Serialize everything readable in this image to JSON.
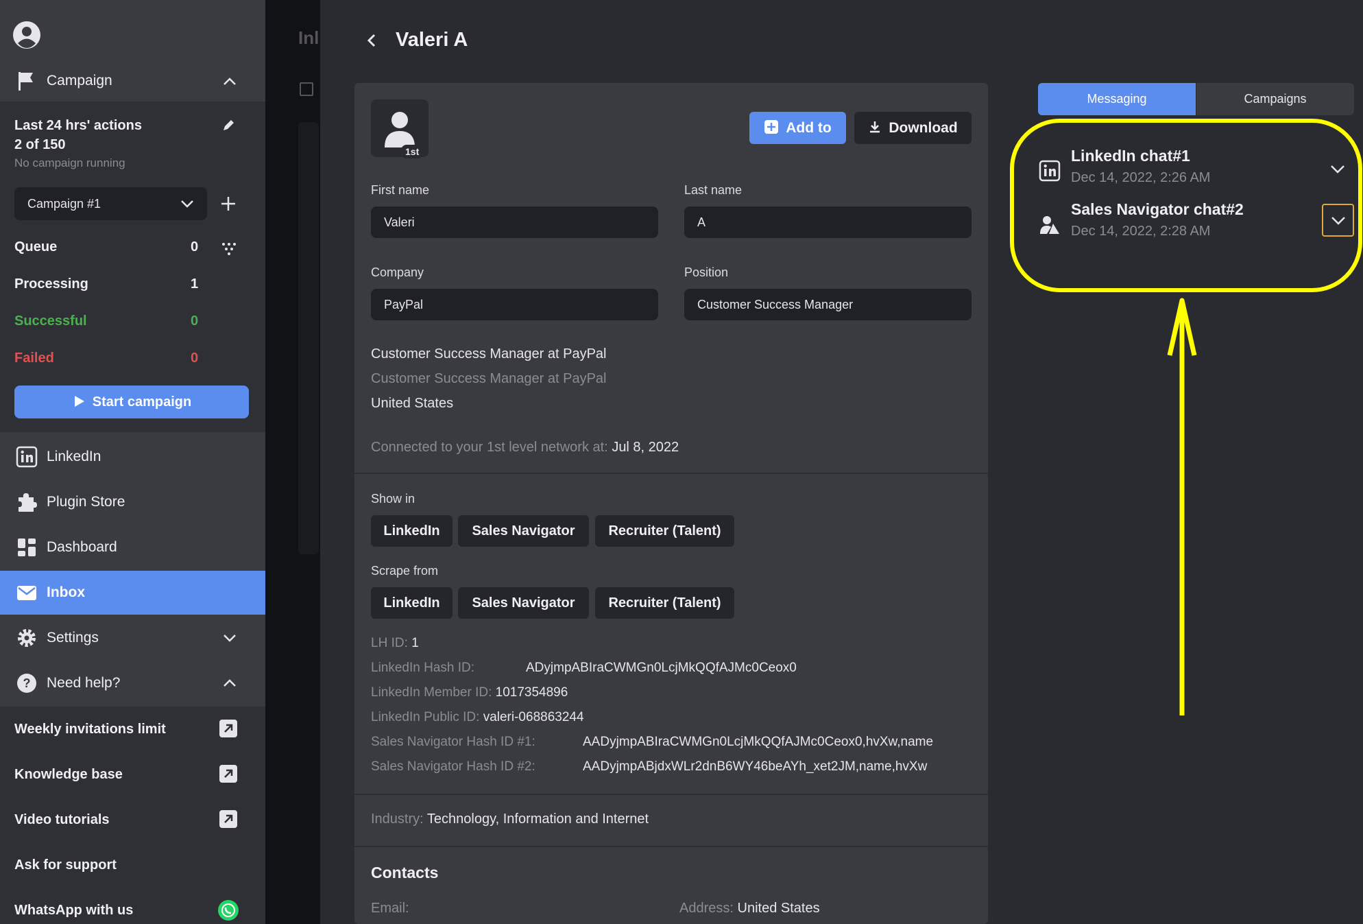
{
  "sidebar": {
    "campaign_label": "Campaign",
    "actions_title": "Last 24 hrs' actions",
    "actions_count": "2 of 150",
    "no_campaign": "No campaign running",
    "campaign_select": "Campaign #1",
    "stats": [
      {
        "label": "Queue",
        "value": "0",
        "color": "#f0f0f3"
      },
      {
        "label": "Processing",
        "value": "1",
        "color": "#f0f0f3"
      },
      {
        "label": "Successful",
        "value": "0",
        "color": "#4caf50"
      },
      {
        "label": "Failed",
        "value": "0",
        "color": "#e05252"
      }
    ],
    "start_button": "Start campaign",
    "nav": [
      {
        "label": "LinkedIn",
        "icon": "linkedin-icon"
      },
      {
        "label": "Plugin Store",
        "icon": "puzzle-icon"
      },
      {
        "label": "Dashboard",
        "icon": "dashboard-icon"
      },
      {
        "label": "Inbox",
        "icon": "mail-icon"
      },
      {
        "label": "Settings",
        "icon": "gear-icon"
      },
      {
        "label": "Need help?",
        "icon": "help-icon"
      }
    ],
    "help_items": [
      "Weekly invitations limit",
      "Knowledge base",
      "Video tutorials",
      "Ask for support",
      "WhatsApp with us"
    ]
  },
  "background": {
    "ghost_title": "Inl"
  },
  "profile": {
    "title": "Valeri A",
    "degree": "1st",
    "add_button": "Add to",
    "download_button": "Download",
    "first_name_label": "First name",
    "first_name": "Valeri",
    "last_name_label": "Last name",
    "last_name": "A",
    "company_label": "Company",
    "company": "PayPal",
    "position_label": "Position",
    "position": "Customer Success Manager",
    "headline": "Customer Success Manager at PayPal",
    "headline_secondary": "Customer Success Manager at PayPal",
    "location": "United States",
    "connected_label": "Connected to your 1st level network at:",
    "connected_date": "Jul 8, 2022",
    "show_in_label": "Show in",
    "scrape_from_label": "Scrape from",
    "chips": [
      "LinkedIn",
      "Sales Navigator",
      "Recruiter (Talent)"
    ],
    "ids": {
      "lh_id_label": "LH ID:",
      "lh_id": "1",
      "hash_label": "LinkedIn Hash ID:",
      "hash": "ADyjmpABIraCWMGn0LcjMkQQfAJMc0Ceox0",
      "member_label": "LinkedIn Member ID:",
      "member": "1017354896",
      "public_label": "LinkedIn Public ID:",
      "public": "valeri-068863244",
      "sn1_label": "Sales Navigator Hash ID #1:",
      "sn1": "AADyjmpABIraCWMGn0LcjMkQQfAJMc0Ceox0,hvXw,name",
      "sn2_label": "Sales Navigator Hash ID #2:",
      "sn2": "AADyjmpABjdxWLr2dnB6WY46beAYh_xet2JM,name,hvXw"
    },
    "industry_label": "Industry:",
    "industry": "Technology, Information and Internet",
    "contacts_title": "Contacts",
    "email_label": "Email:",
    "address_label": "Address:",
    "address": "United States"
  },
  "right_panel": {
    "tabs": [
      "Messaging",
      "Campaigns"
    ],
    "chats": [
      {
        "title": "LinkedIn chat#1",
        "date": "Dec 14, 2022, 2:26 AM",
        "icon": "linkedin-icon"
      },
      {
        "title": "Sales Navigator chat#2",
        "date": "Dec 14, 2022, 2:28 AM",
        "icon": "sales-navigator-icon"
      }
    ]
  },
  "colors": {
    "accent": "#5b8def",
    "highlight": "#ffff00",
    "success": "#4caf50",
    "danger": "#e05252"
  }
}
